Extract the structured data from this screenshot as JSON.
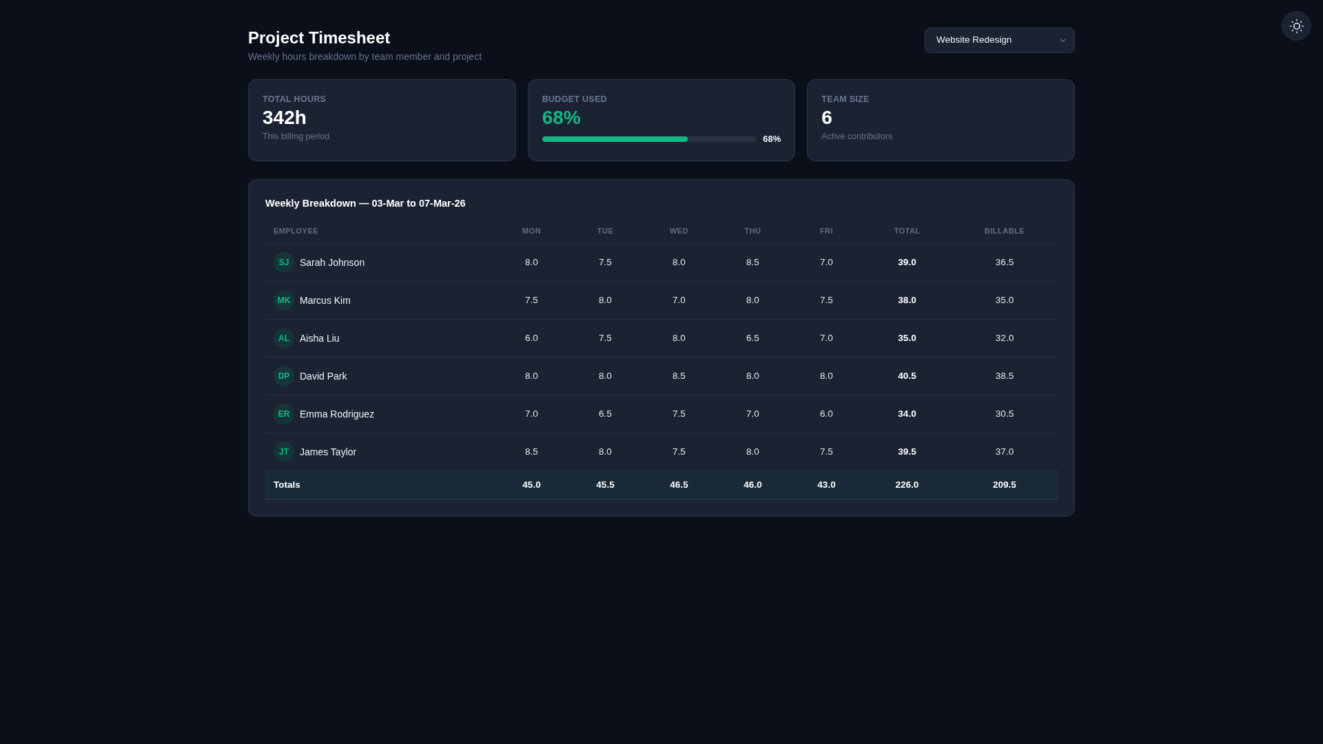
{
  "header": {
    "title": "Project Timesheet",
    "subtitle": "Weekly hours breakdown by team member and project"
  },
  "project_select": {
    "value": "Website Redesign"
  },
  "stats": [
    {
      "kind": "number",
      "label": "TOTAL HOURS",
      "value": "342h",
      "caption": "This billing period"
    },
    {
      "kind": "progress",
      "label": "BUDGET USED",
      "value": "68%",
      "level": 0.68,
      "reading": "68%"
    },
    {
      "kind": "number",
      "label": "TEAM SIZE",
      "value": "6",
      "caption": "Active contributors"
    }
  ],
  "table": {
    "title": "Weekly Breakdown — 03-Mar to 07-Mar-26",
    "columns": [
      "EMPLOYEE",
      "MON",
      "TUE",
      "WED",
      "THU",
      "FRI",
      "TOTAL",
      "BILLABLE"
    ],
    "rows": [
      {
        "initials": "SJ",
        "name": "Sarah Johnson",
        "hours": [
          "8.0",
          "7.5",
          "8.0",
          "8.5",
          "7.0"
        ],
        "total": "39.0",
        "billable": "36.5"
      },
      {
        "initials": "MK",
        "name": "Marcus Kim",
        "hours": [
          "7.5",
          "8.0",
          "7.0",
          "8.0",
          "7.5"
        ],
        "total": "38.0",
        "billable": "35.0"
      },
      {
        "initials": "AL",
        "name": "Aisha Liu",
        "hours": [
          "6.0",
          "7.5",
          "8.0",
          "6.5",
          "7.0"
        ],
        "total": "35.0",
        "billable": "32.0"
      },
      {
        "initials": "DP",
        "name": "David Park",
        "hours": [
          "8.0",
          "8.0",
          "8.5",
          "8.0",
          "8.0"
        ],
        "total": "40.5",
        "billable": "38.5"
      },
      {
        "initials": "ER",
        "name": "Emma Rodriguez",
        "hours": [
          "7.0",
          "6.5",
          "7.5",
          "7.0",
          "6.0"
        ],
        "total": "34.0",
        "billable": "30.5"
      },
      {
        "initials": "JT",
        "name": "James Taylor",
        "hours": [
          "8.5",
          "8.0",
          "7.5",
          "8.0",
          "7.5"
        ],
        "total": "39.5",
        "billable": "37.0"
      }
    ],
    "totals": {
      "label": "Totals",
      "hours": [
        "45.0",
        "45.5",
        "46.5",
        "46.0",
        "43.0"
      ],
      "total": "226.0",
      "billable": "209.5"
    }
  }
}
